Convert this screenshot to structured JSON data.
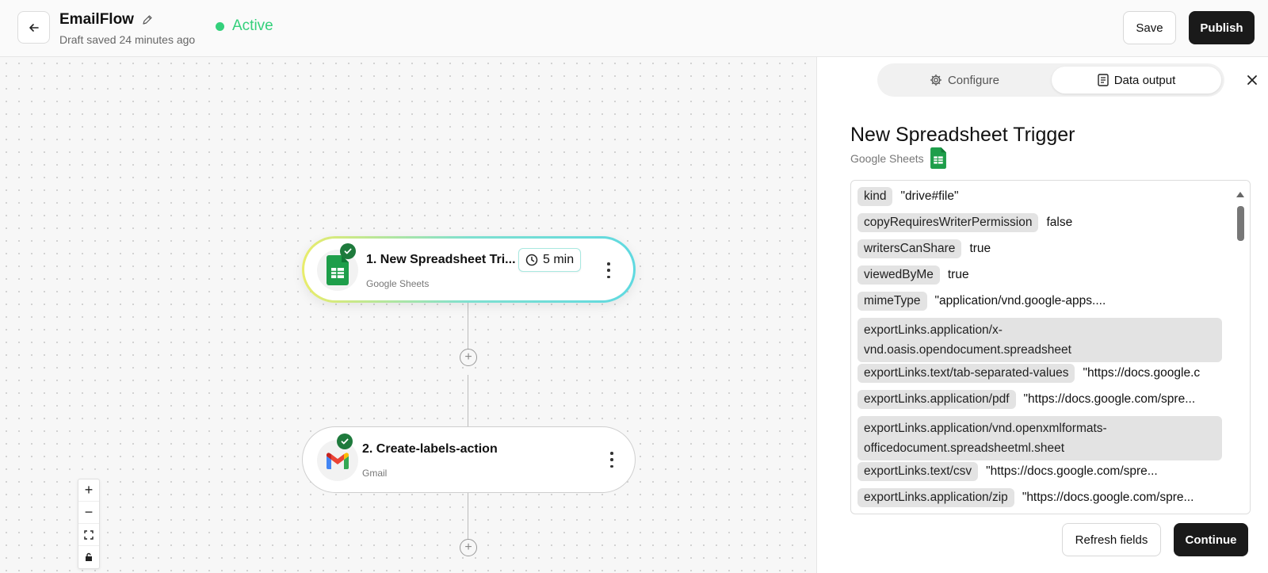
{
  "header": {
    "title": "EmailFlow",
    "subtitle": "Draft saved 24 minutes ago",
    "status": "Active",
    "save_label": "Save",
    "publish_label": "Publish"
  },
  "colors": {
    "active": "#34d07b",
    "primary_button": "#1a1a1a",
    "check": "#1e7a3c"
  },
  "canvas": {
    "nodes": [
      {
        "title": "1. New Spreadsheet Tri...",
        "app": "Google Sheets",
        "timer": "5 min",
        "icon": "google-sheets-icon"
      },
      {
        "title": "2. Create-labels-action",
        "app": "Gmail",
        "icon": "gmail-icon"
      }
    ],
    "zoom_controls": [
      "zoom-in",
      "zoom-out",
      "fit-view",
      "lock"
    ]
  },
  "panel": {
    "tabs": [
      {
        "label": "Configure",
        "icon": "gear-icon"
      },
      {
        "label": "Data output",
        "icon": "document-icon",
        "active": true
      }
    ],
    "title": "New Spreadsheet Trigger",
    "app": "Google Sheets",
    "fields": [
      {
        "key": "kind",
        "value": "\"drive#file\""
      },
      {
        "key": "copyRequiresWriterPermission",
        "value": "false"
      },
      {
        "key": "writersCanShare",
        "value": "true"
      },
      {
        "key": "viewedByMe",
        "value": "true"
      },
      {
        "key": "mimeType",
        "value": "\"application/vnd.google-apps...."
      },
      {
        "key": "exportLinks.application/x-vnd.oasis.opendocument.spreadsheet",
        "line1": "exportLinks.application/x-",
        "line2": "vnd.oasis.opendocument.spreadsheet"
      },
      {
        "key": "exportLinks.text/tab-separated-values",
        "value": "\"https://docs.google.c"
      },
      {
        "key": "exportLinks.application/pdf",
        "value": "\"https://docs.google.com/spre..."
      },
      {
        "key": "exportLinks.application/vnd.openxmlformats-officedocument.spreadsheetml.sheet",
        "line1": "exportLinks.application/vnd.openxmlformats-",
        "line2": "officedocument.spreadsheetml.sheet"
      },
      {
        "key": "exportLinks.text/csv",
        "value": "\"https://docs.google.com/spre..."
      },
      {
        "key": "exportLinks.application/zip",
        "value": "\"https://docs.google.com/spre..."
      }
    ],
    "refresh_label": "Refresh fields",
    "continue_label": "Continue"
  }
}
